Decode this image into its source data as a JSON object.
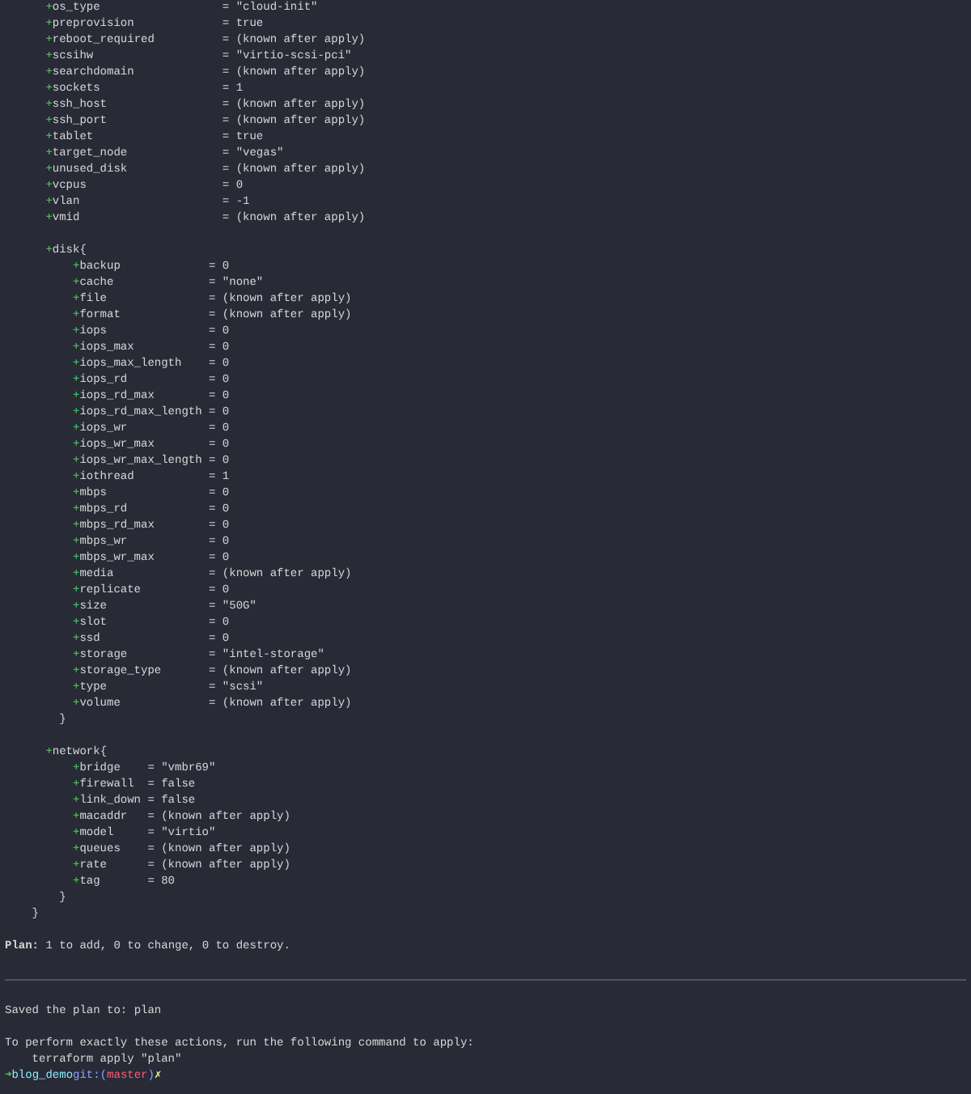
{
  "attributes": [
    {
      "sign": "+",
      "key": "os_type",
      "value": "= \"cloud-init\""
    },
    {
      "sign": "+",
      "key": "preprovision",
      "value": "= true"
    },
    {
      "sign": "+",
      "key": "reboot_required",
      "value": "= (known after apply)"
    },
    {
      "sign": "+",
      "key": "scsihw",
      "value": "= \"virtio-scsi-pci\""
    },
    {
      "sign": "+",
      "key": "searchdomain",
      "value": "= (known after apply)"
    },
    {
      "sign": "+",
      "key": "sockets",
      "value": "= 1"
    },
    {
      "sign": "+",
      "key": "ssh_host",
      "value": "= (known after apply)"
    },
    {
      "sign": "+",
      "key": "ssh_port",
      "value": "= (known after apply)"
    },
    {
      "sign": "+",
      "key": "tablet",
      "value": "= true"
    },
    {
      "sign": "+",
      "key": "target_node",
      "value": "= \"vegas\""
    },
    {
      "sign": "+",
      "key": "unused_disk",
      "value": "= (known after apply)"
    },
    {
      "sign": "+",
      "key": "vcpus",
      "value": "= 0"
    },
    {
      "sign": "+",
      "key": "vlan",
      "value": "= -1"
    },
    {
      "sign": "+",
      "key": "vmid",
      "value": "= (known after apply)"
    }
  ],
  "blocks": [
    {
      "sign": "+",
      "name": "disk",
      "open": "{",
      "close": "}",
      "attributes": [
        {
          "sign": "+",
          "key": "backup",
          "value": "= 0"
        },
        {
          "sign": "+",
          "key": "cache",
          "value": "= \"none\""
        },
        {
          "sign": "+",
          "key": "file",
          "value": "= (known after apply)"
        },
        {
          "sign": "+",
          "key": "format",
          "value": "= (known after apply)"
        },
        {
          "sign": "+",
          "key": "iops",
          "value": "= 0"
        },
        {
          "sign": "+",
          "key": "iops_max",
          "value": "= 0"
        },
        {
          "sign": "+",
          "key": "iops_max_length",
          "value": "= 0"
        },
        {
          "sign": "+",
          "key": "iops_rd",
          "value": "= 0"
        },
        {
          "sign": "+",
          "key": "iops_rd_max",
          "value": "= 0"
        },
        {
          "sign": "+",
          "key": "iops_rd_max_length",
          "value": "= 0"
        },
        {
          "sign": "+",
          "key": "iops_wr",
          "value": "= 0"
        },
        {
          "sign": "+",
          "key": "iops_wr_max",
          "value": "= 0"
        },
        {
          "sign": "+",
          "key": "iops_wr_max_length",
          "value": "= 0"
        },
        {
          "sign": "+",
          "key": "iothread",
          "value": "= 1"
        },
        {
          "sign": "+",
          "key": "mbps",
          "value": "= 0"
        },
        {
          "sign": "+",
          "key": "mbps_rd",
          "value": "= 0"
        },
        {
          "sign": "+",
          "key": "mbps_rd_max",
          "value": "= 0"
        },
        {
          "sign": "+",
          "key": "mbps_wr",
          "value": "= 0"
        },
        {
          "sign": "+",
          "key": "mbps_wr_max",
          "value": "= 0"
        },
        {
          "sign": "+",
          "key": "media",
          "value": "= (known after apply)"
        },
        {
          "sign": "+",
          "key": "replicate",
          "value": "= 0"
        },
        {
          "sign": "+",
          "key": "size",
          "value": "= \"50G\""
        },
        {
          "sign": "+",
          "key": "slot",
          "value": "= 0"
        },
        {
          "sign": "+",
          "key": "ssd",
          "value": "= 0"
        },
        {
          "sign": "+",
          "key": "storage",
          "value": "= \"intel-storage\""
        },
        {
          "sign": "+",
          "key": "storage_type",
          "value": "= (known after apply)"
        },
        {
          "sign": "+",
          "key": "type",
          "value": "= \"scsi\""
        },
        {
          "sign": "+",
          "key": "volume",
          "value": "= (known after apply)"
        }
      ]
    },
    {
      "sign": "+",
      "name": "network",
      "open": "{",
      "close": "}",
      "attributes": [
        {
          "sign": "+",
          "key": "bridge",
          "value": "= \"vmbr69\""
        },
        {
          "sign": "+",
          "key": "firewall",
          "value": "= false"
        },
        {
          "sign": "+",
          "key": "link_down",
          "value": "= false"
        },
        {
          "sign": "+",
          "key": "macaddr",
          "value": "= (known after apply)"
        },
        {
          "sign": "+",
          "key": "model",
          "value": "= \"virtio\""
        },
        {
          "sign": "+",
          "key": "queues",
          "value": "= (known after apply)"
        },
        {
          "sign": "+",
          "key": "rate",
          "value": "= (known after apply)"
        },
        {
          "sign": "+",
          "key": "tag",
          "value": "= 80"
        }
      ]
    }
  ],
  "resource_close": "}",
  "plan_summary": "**Plan:** 1 to add, 0 to change, 0 to destroy.",
  "saved_message": "Saved the plan to: plan",
  "instructions": "To perform exactly these actions, run the following command to apply:",
  "command": "terraform apply \"plan\"",
  "prompt": {
    "arrow": "➜",
    "directory": "blog_demo",
    "git_prefix": "git:(",
    "branch": "master",
    "git_suffix": ")",
    "dirty_mark": "✗"
  }
}
